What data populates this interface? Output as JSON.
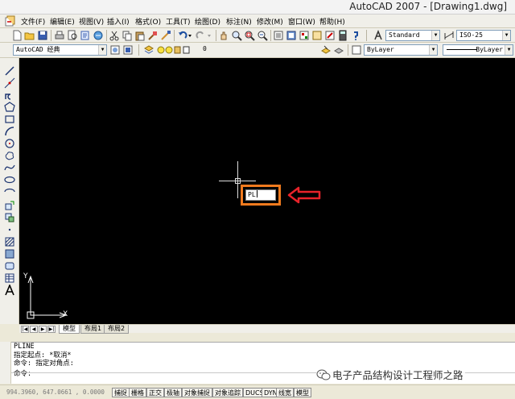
{
  "window": {
    "title": "AutoCAD 2007 - [Drawing1.dwg]"
  },
  "menu": {
    "items": [
      "文件(F)",
      "编辑(E)",
      "视图(V)",
      "插入(I)",
      "格式(O)",
      "工具(T)",
      "绘图(D)",
      "标注(N)",
      "修改(M)",
      "窗口(W)",
      "帮助(H)"
    ]
  },
  "toolbar_standard": {
    "text_style": "Standard",
    "dim_style": "ISO-25"
  },
  "toolbar_layers": {
    "workspace": "AutoCAD 经典",
    "layer": "0",
    "color": "ByLayer",
    "linetype": "ByLayer"
  },
  "drawing": {
    "dynamic_input_text": "PL",
    "ucs_x_label": "X",
    "ucs_y_label": "Y",
    "annotation_colors": {
      "highlight": "#f07a1e",
      "arrow": "#e8232a"
    }
  },
  "layout_tabs": [
    "模型",
    "布局1",
    "布局2"
  ],
  "command_line": {
    "history": [
      "PLINE",
      "指定起点: *取消*",
      "命令: 指定对角点:"
    ],
    "prompt": "命令:"
  },
  "watermark": {
    "text": "电子产品结构设计工程师之路"
  },
  "status_bar": {
    "coordinates": "994.3960,  647.0661 , 0.0000",
    "toggles": [
      "捕捉",
      "栅格",
      "正交",
      "极轴",
      "对象捕捉",
      "对象追踪",
      "DUCS",
      "DYN",
      "线宽",
      "模型"
    ]
  }
}
